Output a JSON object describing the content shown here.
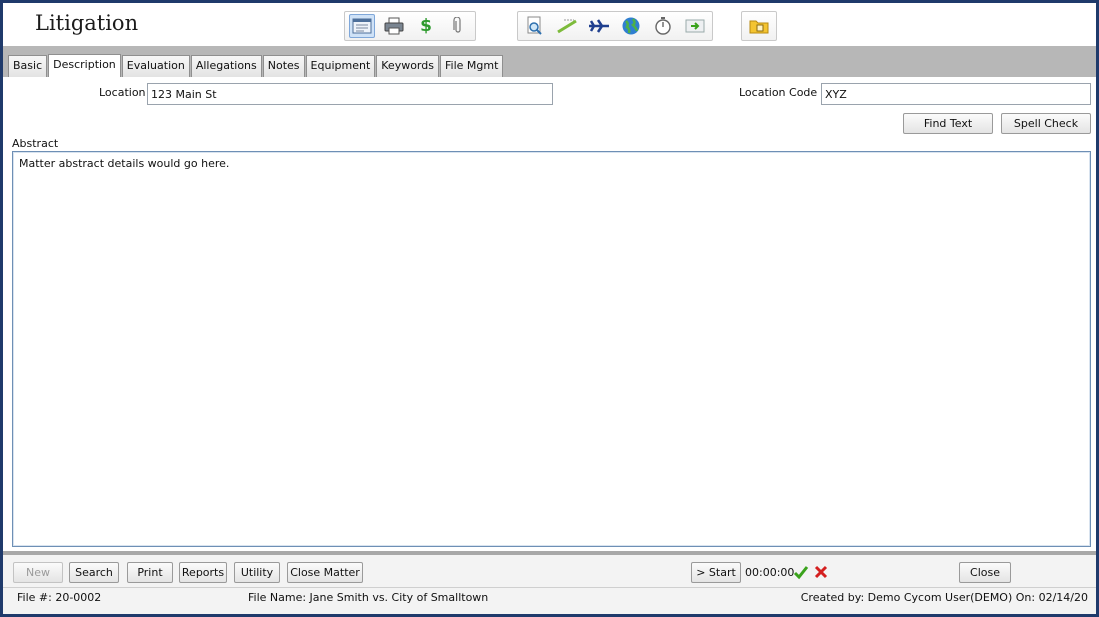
{
  "app": {
    "title": "Litigation"
  },
  "toolbar": {
    "group1": [
      "form-view-icon",
      "printer-icon",
      "dollar-icon",
      "paperclip-icon"
    ],
    "group2": [
      "document-search-icon",
      "pen-icon",
      "airplane-icon",
      "globe-icon",
      "stopwatch-icon",
      "export-icon"
    ],
    "group3": [
      "folder-lock-icon"
    ]
  },
  "tabs": [
    "Basic",
    "Description",
    "Evaluation",
    "Allegations",
    "Notes",
    "Equipment",
    "Keywords",
    "File Mgmt"
  ],
  "form": {
    "location_label": "Location",
    "location_value": "123 Main St",
    "location_code_label": "Location Code",
    "location_code_value": "XYZ",
    "find_text": "Find Text",
    "spell_check": "Spell Check",
    "abstract_label": "Abstract",
    "abstract_value": "Matter abstract details would go here."
  },
  "bottom": {
    "new": "New",
    "search": "Search",
    "print": "Print",
    "reports": "Reports",
    "utility": "Utility",
    "close_matter": "Close Matter",
    "start": "> Start",
    "timer": "00:00:00",
    "close": "Close"
  },
  "status": {
    "file_number": "File #: 20-0002",
    "file_name": "File Name: Jane Smith vs. City of Smalltown",
    "created": "Created by: Demo Cycom User(DEMO) On: 02/14/20"
  },
  "colors": {
    "frame": "#1f3a6b",
    "tabbar": "#b7b7b7",
    "accent": "#7fa7d9",
    "check": "#3aa21c",
    "cross": "#d41f1f"
  }
}
